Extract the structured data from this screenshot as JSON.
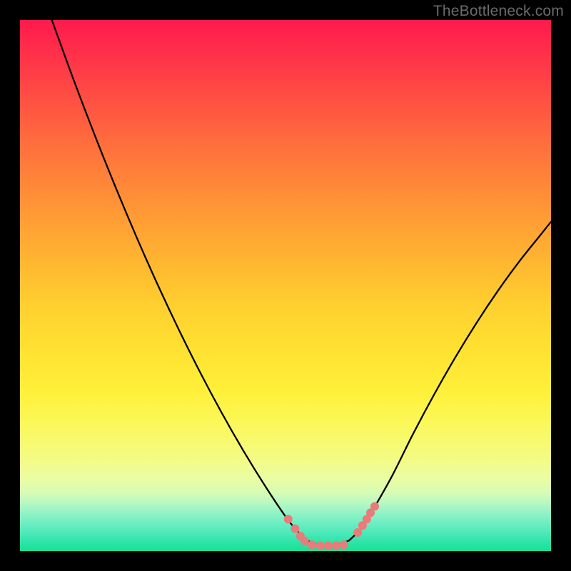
{
  "watermark": {
    "text": "TheBottleneck.com"
  },
  "colors": {
    "background": "#000000",
    "curve": "#000000",
    "marker_fill": "#e97b7b",
    "marker_stroke": "#d86a6a",
    "gradient_top": "#ff1a4d",
    "gradient_bottom": "#18e096"
  },
  "chart_data": {
    "type": "line",
    "title": "",
    "xlabel": "",
    "ylabel": "",
    "xlim": [
      0,
      100
    ],
    "ylim": [
      0,
      100
    ],
    "grid": false,
    "legend": false,
    "series": [
      {
        "name": "left-curve",
        "x": [
          6,
          10,
          14,
          18,
          22,
          26,
          30,
          34,
          38,
          42,
          46,
          50,
          52,
          54
        ],
        "y": [
          100,
          89,
          78.5,
          68.5,
          59,
          50,
          41.5,
          33.5,
          26,
          19,
          12.5,
          6.5,
          4,
          2
        ]
      },
      {
        "name": "right-curve",
        "x": [
          62,
          64,
          66,
          70,
          74,
          78,
          82,
          86,
          90,
          94,
          98,
          100
        ],
        "y": [
          2,
          4,
          7,
          14,
          22,
          29.5,
          36.5,
          43,
          49,
          54.5,
          59.5,
          62
        ]
      },
      {
        "name": "valley-floor",
        "x": [
          54,
          56,
          58,
          60,
          62
        ],
        "y": [
          2,
          1.2,
          1,
          1.2,
          2
        ]
      }
    ],
    "markers": [
      {
        "name": "left-cluster",
        "x": 50.5,
        "y": 6.0
      },
      {
        "name": "left-cluster",
        "x": 51.8,
        "y": 4.2
      },
      {
        "name": "left-cluster",
        "x": 52.8,
        "y": 2.8
      },
      {
        "name": "left-cluster",
        "x": 53.6,
        "y": 1.9
      },
      {
        "name": "floor",
        "x": 55.0,
        "y": 1.2
      },
      {
        "name": "floor",
        "x": 56.5,
        "y": 1.0
      },
      {
        "name": "floor",
        "x": 58.0,
        "y": 1.0
      },
      {
        "name": "floor",
        "x": 59.5,
        "y": 1.0
      },
      {
        "name": "floor",
        "x": 61.0,
        "y": 1.2
      },
      {
        "name": "right-cluster",
        "x": 63.6,
        "y": 3.5
      },
      {
        "name": "right-cluster",
        "x": 64.5,
        "y": 4.8
      },
      {
        "name": "right-cluster",
        "x": 65.3,
        "y": 6.0
      },
      {
        "name": "right-cluster",
        "x": 66.0,
        "y": 7.2
      },
      {
        "name": "right-cluster",
        "x": 66.8,
        "y": 8.4
      }
    ]
  }
}
